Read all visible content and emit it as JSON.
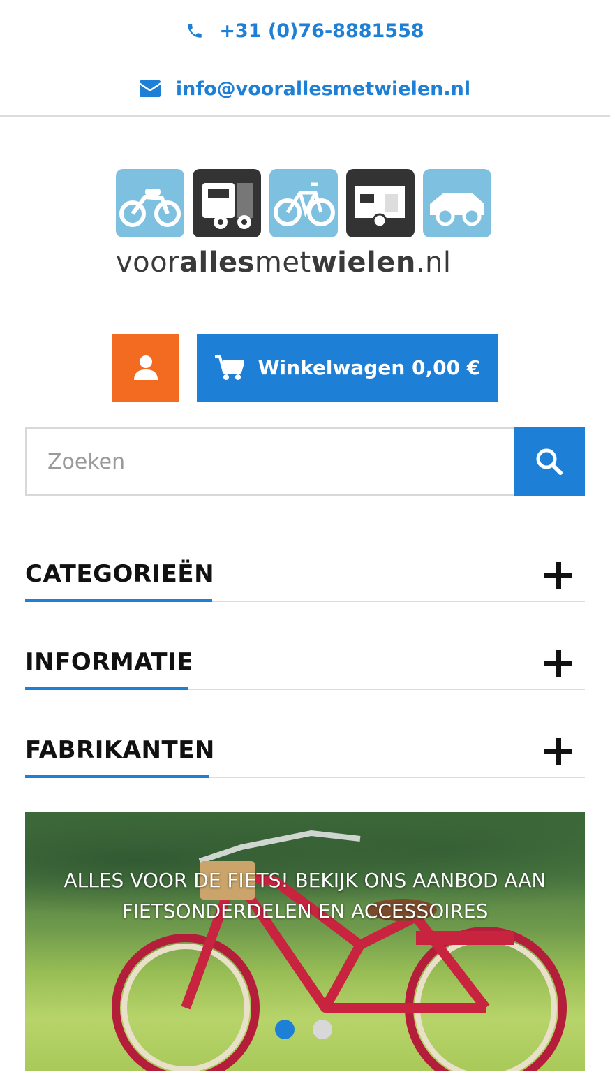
{
  "contact": {
    "phone": "+31 (0)76-8881558",
    "email": "info@voorallesmetwielen.nl"
  },
  "logo": {
    "part1": "voor",
    "part2": "alles",
    "part3": "met",
    "part4": "wielen",
    "part5": ".nl",
    "tiles": [
      "motorcycle-icon",
      "truck-icon",
      "bicycle-icon",
      "caravan-icon",
      "car-icon"
    ]
  },
  "header": {
    "cart_label": "Winkelwagen 0,00 €"
  },
  "search": {
    "placeholder": "Zoeken"
  },
  "sections": [
    {
      "title": "CATEGORIEËN"
    },
    {
      "title": "INFORMATIE"
    },
    {
      "title": "FABRIKANTEN"
    }
  ],
  "banner": {
    "line1": "ALLES VOOR DE FIETS! BEKIJK ONS AANBOD AAN",
    "line2": "FIETSONDERDELEN EN ACCESSOIRES",
    "slides_total": 2,
    "active_slide": 1
  },
  "colors": {
    "accent_blue": "#1e7fd6",
    "accent_orange": "#f26b21",
    "logo_light": "#7ec0df",
    "logo_dark": "#333333"
  }
}
